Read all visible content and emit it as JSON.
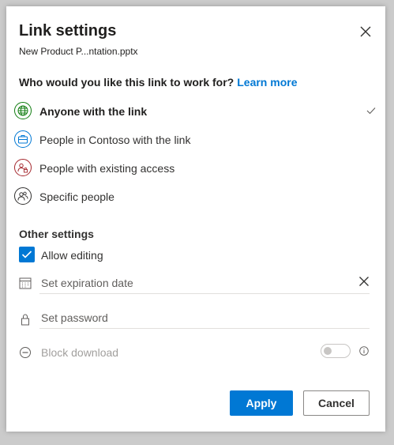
{
  "dialog": {
    "title": "Link settings",
    "filename": "New Product P...ntation.pptx"
  },
  "audience": {
    "question": "Who would you like this link to work for?",
    "learn_more": "Learn more",
    "options": [
      {
        "label": "Anyone with the link",
        "icon": "globe-icon",
        "color": "#107c10",
        "selected": true
      },
      {
        "label": "People in Contoso with the link",
        "icon": "briefcase-icon",
        "color": "#0078d4",
        "selected": false
      },
      {
        "label": "People with existing access",
        "icon": "people-lock-icon",
        "color": "#a4262c",
        "selected": false
      },
      {
        "label": "Specific people",
        "icon": "people-icon",
        "color": "#323130",
        "selected": false
      }
    ]
  },
  "other_settings": {
    "heading": "Other settings",
    "allow_editing": {
      "label": "Allow editing",
      "checked": true
    },
    "expiration": {
      "placeholder": "Set expiration date"
    },
    "password": {
      "placeholder": "Set password"
    },
    "block_download": {
      "label": "Block download",
      "enabled": false,
      "disabled": true
    }
  },
  "buttons": {
    "apply": "Apply",
    "cancel": "Cancel"
  },
  "colors": {
    "accent": "#0078d4",
    "anyone": "#107c10",
    "existing": "#a4262c"
  }
}
